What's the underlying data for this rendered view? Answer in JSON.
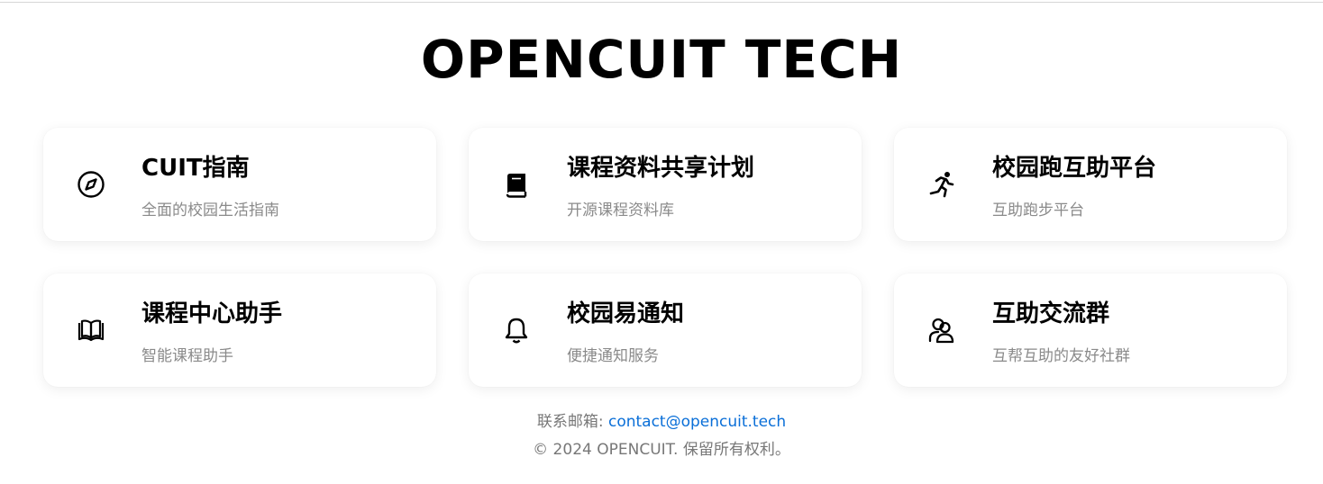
{
  "header": {
    "title": "OPENCUIT TECH"
  },
  "cards": [
    {
      "name": "CUIT指南",
      "description": "全面的校园生活指南",
      "icon": "compass-icon"
    },
    {
      "name": "课程资料共享计划",
      "description": "开源课程资料库",
      "icon": "book-icon"
    },
    {
      "name": "校园跑互助平台",
      "description": "互助跑步平台",
      "icon": "running-person-icon"
    },
    {
      "name": "课程中心助手",
      "description": "智能课程助手",
      "icon": "open-book-icon"
    },
    {
      "name": "校园易通知",
      "description": "便捷通知服务",
      "icon": "bell-icon"
    },
    {
      "name": "互助交流群",
      "description": "互帮互助的友好社群",
      "icon": "users-icon"
    }
  ],
  "footer": {
    "contact_label": "联系邮箱: ",
    "contact_email": "contact@opencuit.tech",
    "copyright": "© 2024 OPENCUIT. 保留所有权利。"
  },
  "colors": {
    "link": "#0a6fd8",
    "muted_text": "#8a8a8a",
    "background": "#ffffff"
  }
}
